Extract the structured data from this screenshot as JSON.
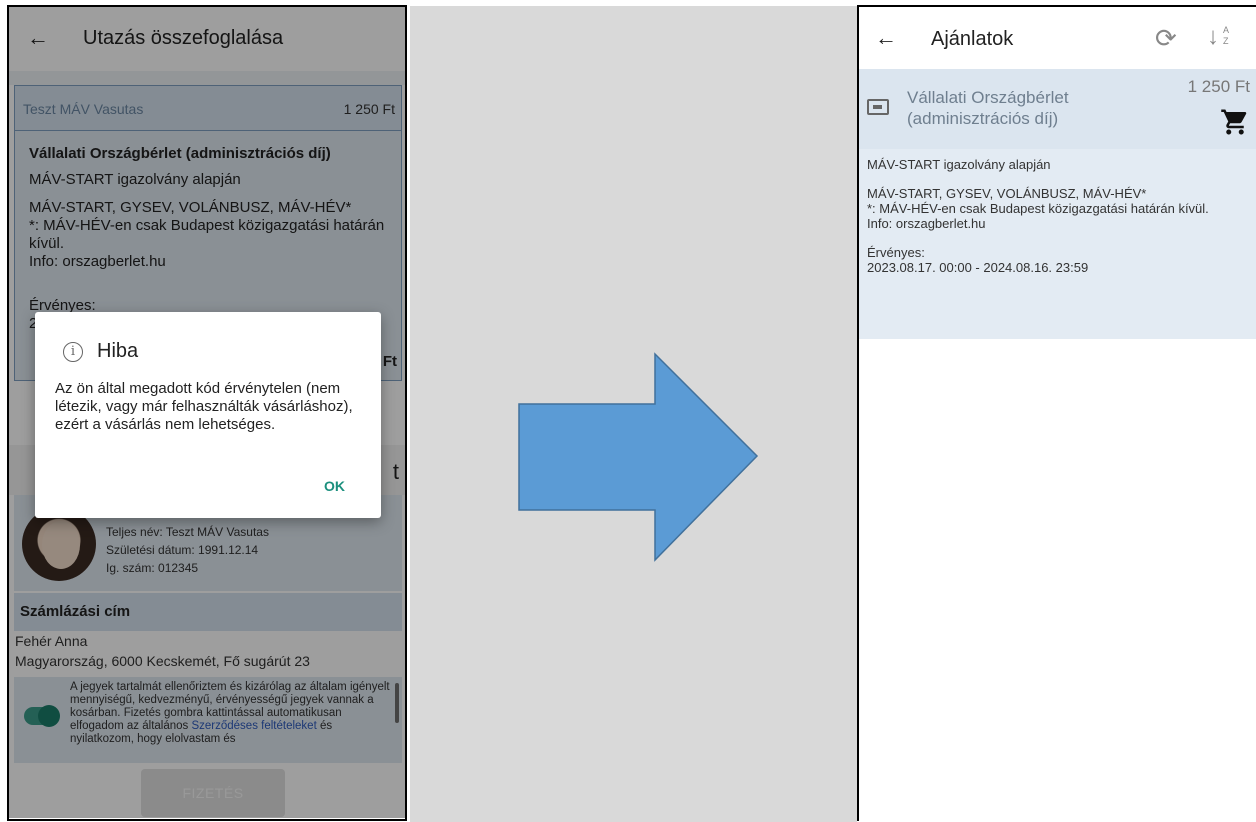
{
  "left": {
    "header": {
      "back_icon": "←",
      "title": "Utazás összefoglalása"
    },
    "card_head": {
      "name": "Teszt MÁV Vasutas",
      "price": "1 250 Ft"
    },
    "card": {
      "title": "Vállalati Országbérlet (adminisztrációs díj)",
      "line1": "MÁV-START igazolvány alapján",
      "line2": "MÁV-START, GYSEV, VOLÁNBUSZ, MÁV-HÉV*",
      "line3": "*: MÁV-HÉV-en csak Budapest közigazgatási határán kívül.",
      "line4": "Info: orszagberlet.hu",
      "valid_label": "Érvényes:",
      "valid_partial": "2",
      "price_partial": "Ft"
    },
    "section2_partial": "t",
    "person": {
      "name_line": "Teljes név: Teszt MÁV Vasutas",
      "dob_line": "Születési dátum: 1991.12.14",
      "id_line": "Ig. szám: 012345"
    },
    "billing": {
      "heading": "Számlázási cím",
      "name": "Fehér Anna",
      "address": "Magyarország, 6000 Kecskemét, Fő sugárút 23"
    },
    "consent": {
      "text_a": "A jegyek tartalmát ellenőriztem és kizárólag az általam igényelt mennyiségű, kedvezményű, érvényességű jegyek vannak a kosárban. Fizetés gombra kattintással automatikusan elfogadom az általános ",
      "link_a": "Szerződéses feltételeket",
      "text_b": " és nyilatkozom, hogy elolvastam és",
      "toggle_on": true
    },
    "pay_button": "FIZETÉS",
    "dialog": {
      "icon": "info-icon",
      "title": "Hiba",
      "message": "Az ön által megadott kód érvénytelen (nem létezik, vagy már felhasználták vásárláshoz), ezért a vásárlás nem lehetséges.",
      "ok": "OK"
    }
  },
  "right": {
    "header": {
      "back_icon": "←",
      "title": "Ajánlatok",
      "refresh_icon": "refresh-icon",
      "sort_icon": "sort-az-icon"
    },
    "offer": {
      "name": "Vállalati Országbérlet (adminisztrációs díj)",
      "price": "1 250 Ft",
      "cart_icon": "cart-icon",
      "desc1": "MÁV-START igazolvány alapján",
      "desc2": "MÁV-START, GYSEV, VOLÁNBUSZ, MÁV-HÉV*",
      "desc3": "*: MÁV-HÉV-en csak Budapest közigazgatási határán kívül.",
      "desc4": "Info: orszagberlet.hu",
      "valid_label": "Érvényes:",
      "valid_range": "2023.08.17. 00:00 - 2024.08.16. 23:59"
    }
  },
  "colors": {
    "accent": "#1b8f7d",
    "arrow_fill": "#5b9bd5",
    "arrow_stroke": "#41719c",
    "card_bg": "#dfe8f1",
    "middle_bg": "#d9d9d9"
  }
}
